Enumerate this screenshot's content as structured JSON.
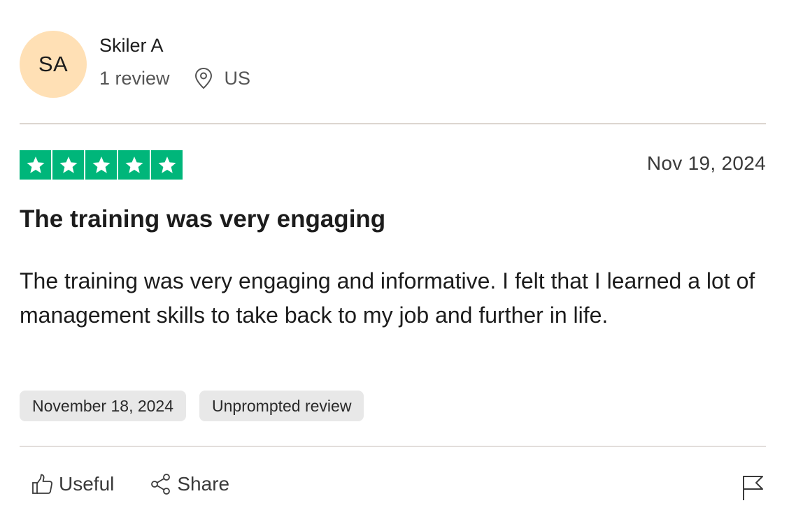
{
  "reviewer": {
    "initials": "SA",
    "name": "Skiler A",
    "review_count": "1 review",
    "country": "US"
  },
  "review": {
    "rating": 5,
    "date": "Nov 19, 2024",
    "title": "The training was very engaging",
    "body": "The training was very engaging and informative. I felt that I learned a lot of management skills to take back to my job and further in life.",
    "tags": [
      "November 18, 2024",
      "Unprompted review"
    ]
  },
  "actions": {
    "useful_label": "Useful",
    "share_label": "Share"
  },
  "colors": {
    "star_green": "#00b67a",
    "avatar_bg": "#ffe0b5",
    "tag_bg": "#e8e8e8"
  },
  "icons": {
    "location": "map-pin-icon",
    "useful": "thumbs-up-icon",
    "share": "share-icon",
    "report": "flag-icon",
    "star": "star-icon"
  }
}
